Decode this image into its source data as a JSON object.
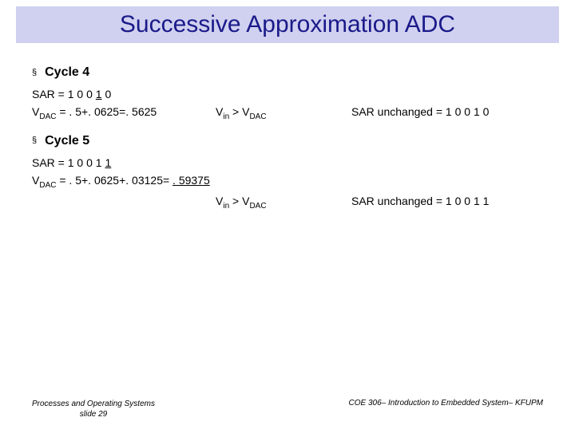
{
  "title": "Successive Approximation ADC",
  "cycle4": {
    "heading": "Cycle 4",
    "bullet": "§",
    "sar_prefix": "SAR = 1 0 0 ",
    "sar_underlined": "1",
    "sar_suffix": " 0",
    "vdac_label_v": "V",
    "vdac_label_dac": "DAC",
    "vdac_eq": " = . 5+. 0625=. 5625",
    "vin_v": "V",
    "vin_in": "in",
    "gt": " > V",
    "unchanged": "SAR unchanged = 1 0 0 1 0"
  },
  "cycle5": {
    "heading": "Cycle 5",
    "bullet": "§",
    "sar_prefix": "SAR = 1 0 0 1 ",
    "sar_underlined": "1",
    "vdac_eq_pre": " = . 5+. 0625+. 03125= ",
    "vdac_result": ". 59375",
    "unchanged": "SAR unchanged = 1 0 0 1 1"
  },
  "footer": {
    "left_line1": "Processes and Operating Systems",
    "left_line2": "slide 29",
    "right": "COE 306– Introduction to Embedded System– KFUPM"
  }
}
